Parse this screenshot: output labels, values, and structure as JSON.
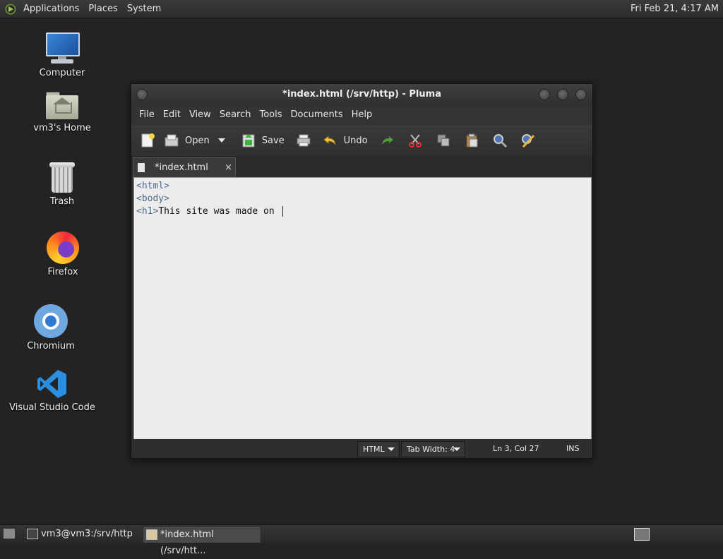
{
  "top_panel": {
    "menus": [
      "Applications",
      "Places",
      "System"
    ],
    "clock": "Fri Feb 21,  4:17 AM"
  },
  "desktop_icons": {
    "computer": "Computer",
    "home": "vm3's Home",
    "trash": "Trash",
    "firefox": "Firefox",
    "chromium": "Chromium",
    "vscode": "Visual Studio Code"
  },
  "window": {
    "title": "*index.html (/srv/http) - Pluma",
    "menu": [
      "File",
      "Edit",
      "View",
      "Search",
      "Tools",
      "Documents",
      "Help"
    ],
    "toolbar": {
      "new_icon": "new-document-icon",
      "open_label": "Open",
      "save_label": "Save",
      "print_icon": "print-icon",
      "undo_label": "Undo",
      "redo_icon": "redo-icon",
      "cut_icon": "cut-icon",
      "copy_icon": "copy-icon",
      "paste_icon": "paste-icon",
      "find_icon": "find-icon",
      "replace_icon": "replace-icon"
    },
    "tab": {
      "label": "*index.html",
      "close": "×"
    },
    "editor_lines": [
      {
        "tag": "<html>",
        "text": ""
      },
      {
        "tag": "<body>",
        "text": ""
      },
      {
        "tag": "<h1>",
        "text": "This site was made on "
      }
    ],
    "status": {
      "language": "HTML",
      "tab_width": "Tab Width:  4",
      "position": "Ln 3, Col 27",
      "mode": "INS"
    }
  },
  "bottom_panel": {
    "tasks": [
      "vm3@vm3:/srv/http",
      "*index.html (/srv/htt..."
    ]
  }
}
